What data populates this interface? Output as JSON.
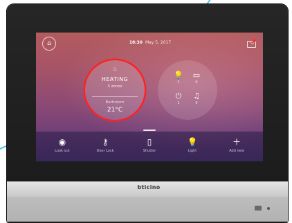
{
  "device": {
    "brand": "bticino"
  },
  "status_bar": {
    "time": "18:30",
    "date": "May 5, 2017"
  },
  "heating": {
    "title": "HEATING",
    "subtitle": "3 zones",
    "label": "Bathroom",
    "temperature": "21°C"
  },
  "quick_actions": [
    {
      "icon": "lightbulb-icon",
      "value": "2"
    },
    {
      "icon": "shutter-icon",
      "value": "0"
    },
    {
      "icon": "plug-icon",
      "value": "1"
    },
    {
      "icon": "music-icon",
      "value": "0"
    }
  ],
  "bottom_bar": {
    "items": [
      {
        "icon": "eye-icon",
        "label": "Look out"
      },
      {
        "icon": "key-icon",
        "label": "Door Lock"
      },
      {
        "icon": "shutter-icon",
        "label": "Shutter"
      },
      {
        "icon": "lightbulb-icon",
        "label": "Light"
      },
      {
        "icon": "plus-icon",
        "label": "Add new"
      }
    ]
  },
  "colors": {
    "highlight": "#ff2222",
    "accent_line": "#48c4e8",
    "notification_badge": "#ff3030"
  }
}
